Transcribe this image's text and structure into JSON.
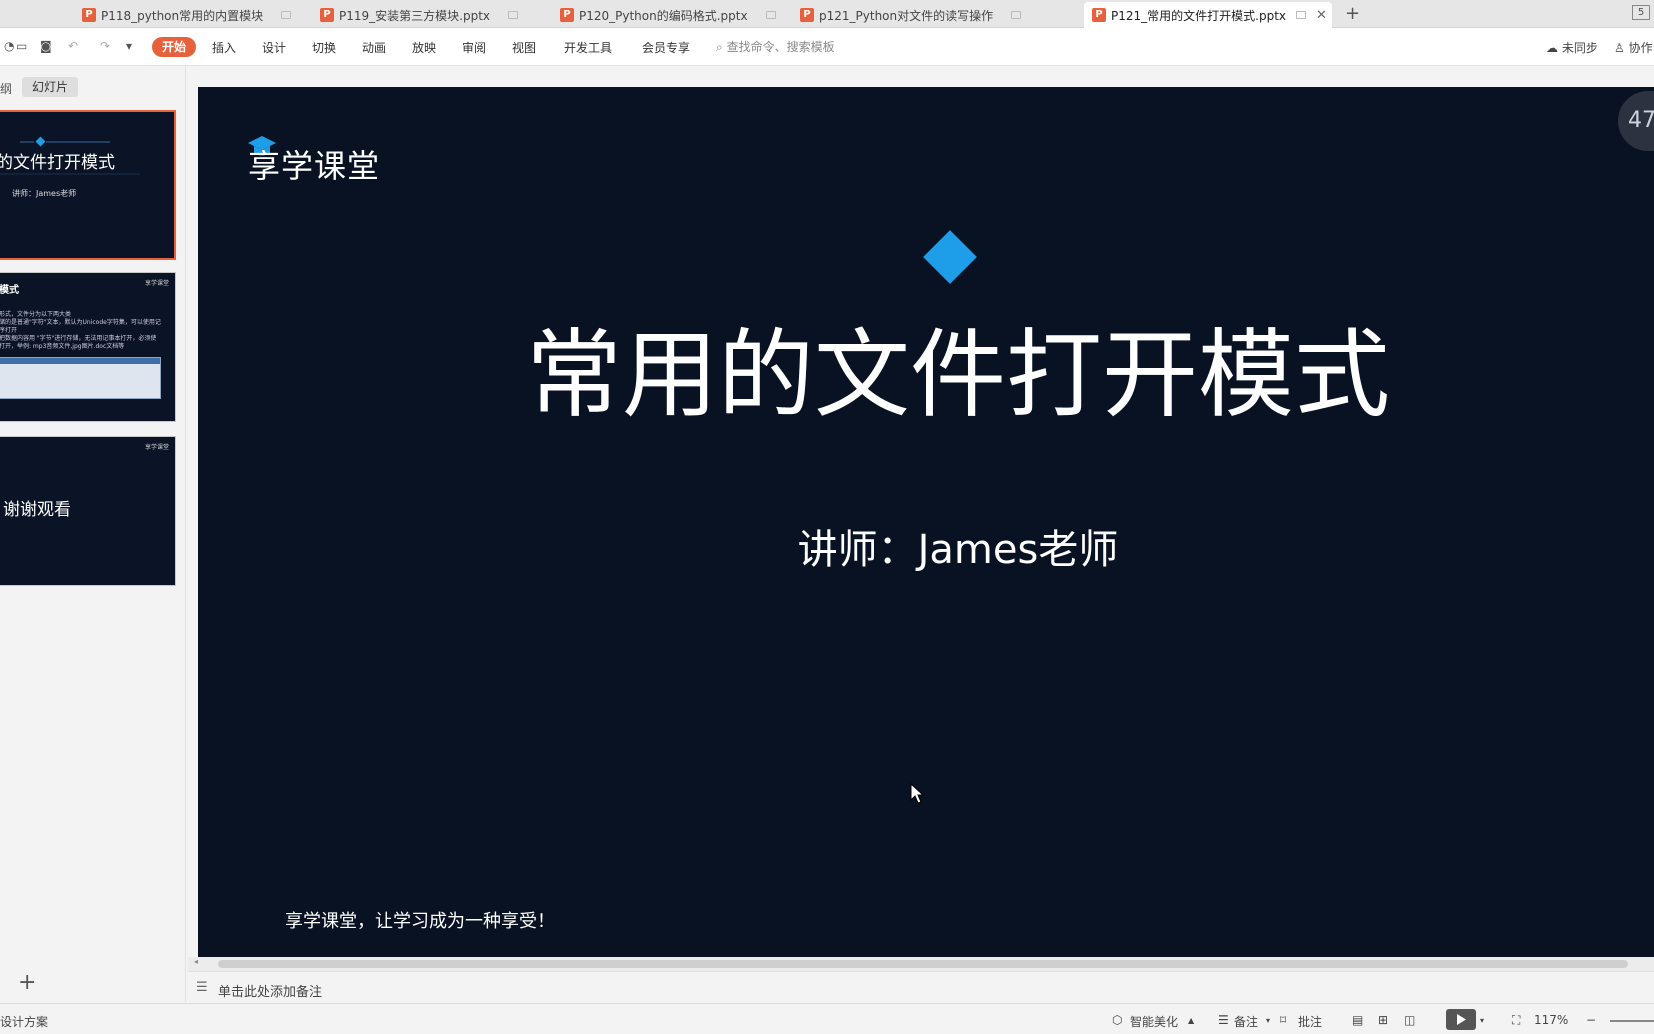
{
  "tabs": [
    {
      "icon": "P",
      "label": "P118_python常用的内置模块"
    },
    {
      "icon": "P",
      "label": "P119_安装第三方模块.pptx"
    },
    {
      "icon": "P",
      "label": "P120_Python的编码格式.pptx"
    },
    {
      "icon": "P",
      "label": "p121_Python对文件的读写操作"
    },
    {
      "icon": "P",
      "label": "P121_常用的文件打开模式.pptx"
    }
  ],
  "new_tab": "+",
  "close_glyph": "✕",
  "window_number": "5",
  "menu": {
    "start": "开始",
    "items": [
      "插入",
      "设计",
      "切换",
      "动画",
      "放映",
      "审阅",
      "视图",
      "开发工具",
      "会员专享"
    ],
    "search_placeholder": "查找命令、搜索模板",
    "sync": "未同步",
    "collab": "协作"
  },
  "left_panel": {
    "outline_tab": "纲",
    "slides_tab": "幻灯片",
    "thumb1": {
      "title": "的文件打开模式",
      "subtitle": "讲师：James老师"
    },
    "thumb2": {
      "title": "模式",
      "lines": [
        "形式，文件分为以下两大类",
        "储的是普通\"字符\"文本，默认为Unicode字符集，可以使用记",
        "序打开",
        "把数据内容用 \"字节\"进行存储，无法用记事本打开，必须使",
        "打开，举例: mp3音频文件,jpg图片.doc文档等"
      ]
    },
    "thumb3": {
      "text": "谢谢观看"
    },
    "mini_logo": "享学课堂",
    "add_slide": "+"
  },
  "slide": {
    "logo": "享学课堂",
    "title": "常用的文件打开模式",
    "subtitle": "讲师：James老师",
    "slogan": "享学课堂，让学习成为一种享受！",
    "timer": "47",
    "accent_color": "#1e9de8",
    "background_color": "#081223"
  },
  "notes": {
    "placeholder": "单击此处添加备注"
  },
  "status": {
    "left": "设计方案",
    "smart": "智能美化",
    "notes": "备注",
    "comment": "批注",
    "zoom": "117%"
  },
  "colors": {
    "brand": "#e8613d"
  }
}
